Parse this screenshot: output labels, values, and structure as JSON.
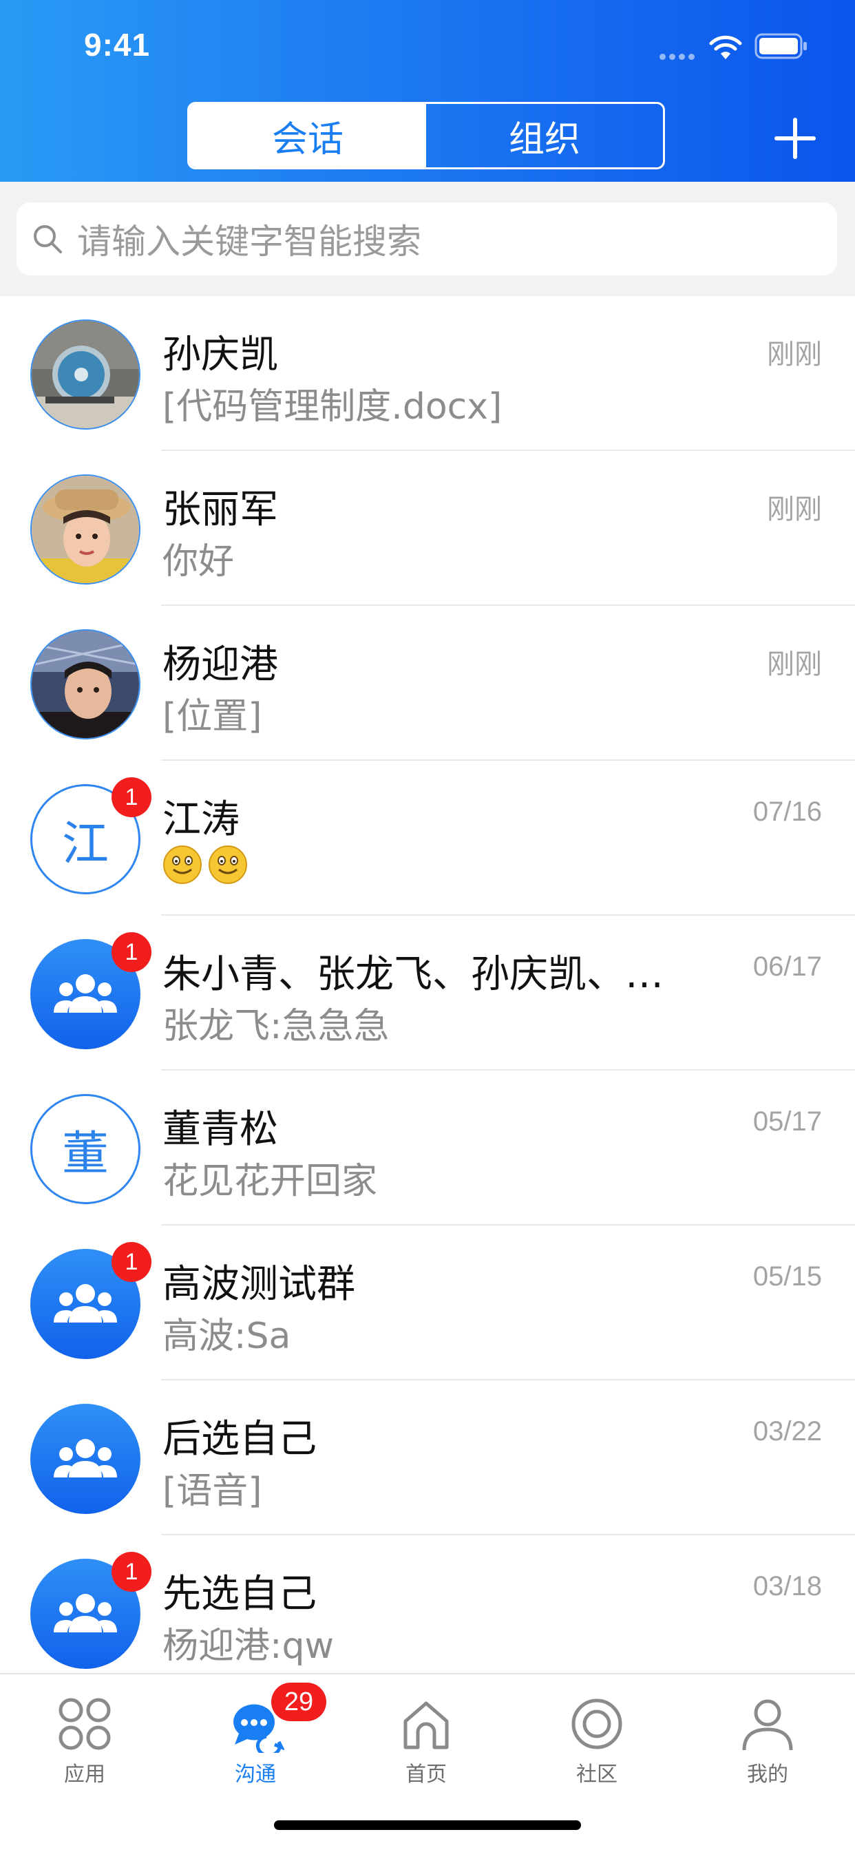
{
  "status_bar": {
    "time": "9:41"
  },
  "header": {
    "tabs": [
      {
        "label": "会话",
        "active": true
      },
      {
        "label": "组织",
        "active": false
      }
    ],
    "add_icon": "plus-icon"
  },
  "search": {
    "placeholder": "请输入关键字智能搜索"
  },
  "conversations": [
    {
      "name": "孙庆凯",
      "preview": "[代码管理制度.docx]",
      "time": "刚刚",
      "avatar_type": "photo",
      "badge": ""
    },
    {
      "name": "张丽军",
      "preview": "你好",
      "time": "刚刚",
      "avatar_type": "photo",
      "badge": ""
    },
    {
      "name": "杨迎港",
      "preview": "[位置]",
      "time": "刚刚",
      "avatar_type": "photo",
      "badge": ""
    },
    {
      "name": "江涛",
      "preview": "",
      "time": "07/16",
      "avatar_type": "letter",
      "avatar_letter": "江",
      "badge": "1"
    },
    {
      "name": "朱小青、张龙飞、孙庆凯、…",
      "preview": "张龙飞:急急急",
      "time": "06/17",
      "avatar_type": "group",
      "badge": "1"
    },
    {
      "name": "董青松",
      "preview": "花见花开回家",
      "time": "05/17",
      "avatar_type": "letter",
      "avatar_letter": "董",
      "badge": ""
    },
    {
      "name": "高波测试群",
      "preview": "高波:Sa",
      "time": "05/15",
      "avatar_type": "group",
      "badge": "1"
    },
    {
      "name": "后选自己",
      "preview": "[语音]",
      "time": "03/22",
      "avatar_type": "group",
      "badge": ""
    },
    {
      "name": "先选自己",
      "preview": "杨迎港:qw",
      "time": "03/18",
      "avatar_type": "group",
      "badge": "1"
    }
  ],
  "tabbar": {
    "items": [
      {
        "label": "应用",
        "icon": "apps-icon",
        "active": false
      },
      {
        "label": "沟通",
        "icon": "chat-icon",
        "active": true,
        "badge": "29"
      },
      {
        "label": "首页",
        "icon": "home-icon",
        "active": false
      },
      {
        "label": "社区",
        "icon": "community-icon",
        "active": false
      },
      {
        "label": "我的",
        "icon": "profile-icon",
        "active": false
      }
    ]
  },
  "colors": {
    "accent": "#1a7ef3",
    "badge": "#f21d1d",
    "header_gradient_start": "#2a9af5",
    "header_gradient_end": "#0b55ec"
  }
}
